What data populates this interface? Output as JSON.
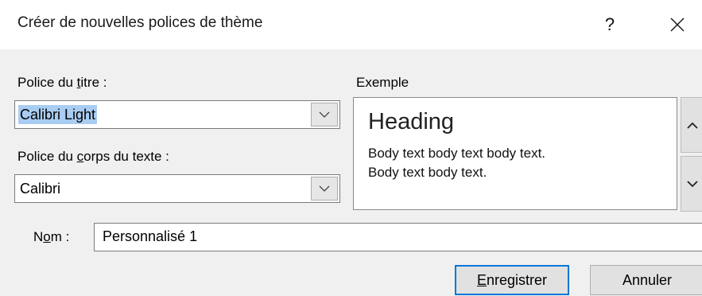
{
  "dialog": {
    "title": "Créer de nouvelles polices de thème",
    "help_label": "?",
    "close_icon": "close-icon"
  },
  "heading_font": {
    "label_pre": "Police du ",
    "label_accel": "t",
    "label_post": "itre :",
    "value": "Calibri Light"
  },
  "body_font": {
    "label_pre": "Police du ",
    "label_accel": "c",
    "label_post": "orps du texte :",
    "value": "Calibri"
  },
  "sample": {
    "label": "Exemple",
    "heading": "Heading",
    "body_line1": "Body text body text body text.",
    "body_line2": "Body text body text."
  },
  "name": {
    "label_pre": "N",
    "label_accel": "o",
    "label_post": "m :",
    "value": "Personnalisé 1"
  },
  "buttons": {
    "save_accel": "E",
    "save_rest": "nregistrer",
    "cancel": "Annuler"
  }
}
